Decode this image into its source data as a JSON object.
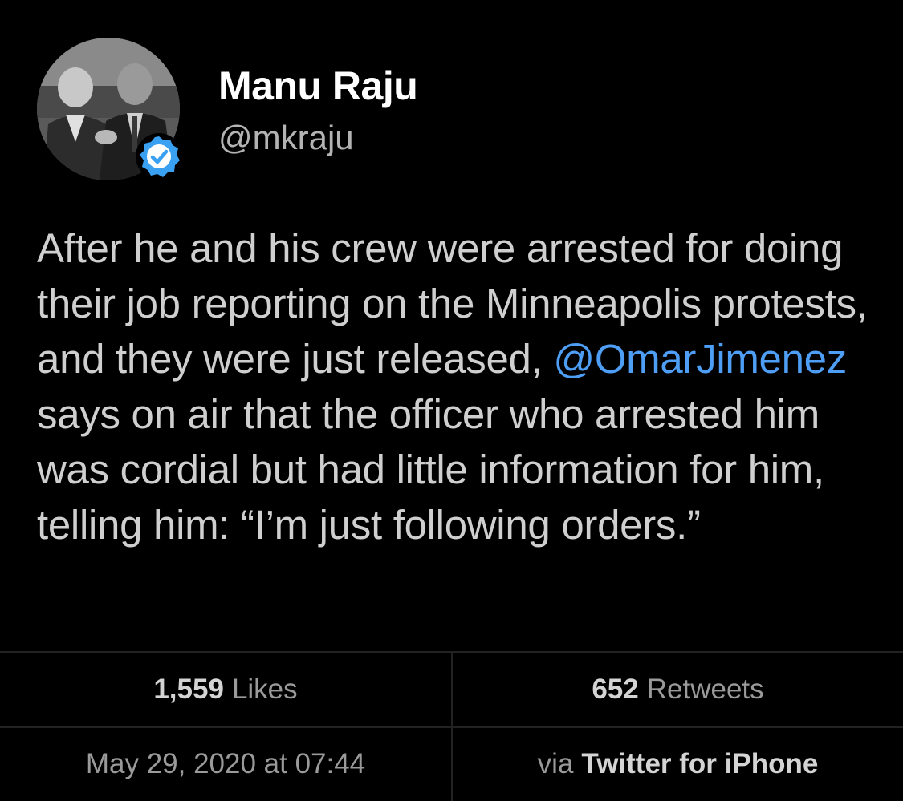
{
  "user": {
    "display_name": "Manu Raju",
    "handle": "@mkraju",
    "verified": true,
    "avatar_icon": "profile-photo",
    "verified_icon": "verified-badge-icon"
  },
  "tweet": {
    "text_before": "After he and his crew were arrested for doing their job reporting on the Minneapolis protests, and they were just released, ",
    "mention": "@OmarJimenez",
    "text_after": " says on air that the officer who arrested him was cordial but had little information for him, telling him: “I’m just following orders.”"
  },
  "stats": {
    "likes_count": "1,559",
    "likes_label": "Likes",
    "retweets_count": "652",
    "retweets_label": "Retweets"
  },
  "meta": {
    "timestamp": "May 29, 2020 at 07:44",
    "via_label": "via",
    "source": "Twitter for iPhone"
  },
  "colors": {
    "background": "#000000",
    "mention": "#4e9ef5",
    "verified": "#3aa0f2",
    "divider": "#222222"
  }
}
